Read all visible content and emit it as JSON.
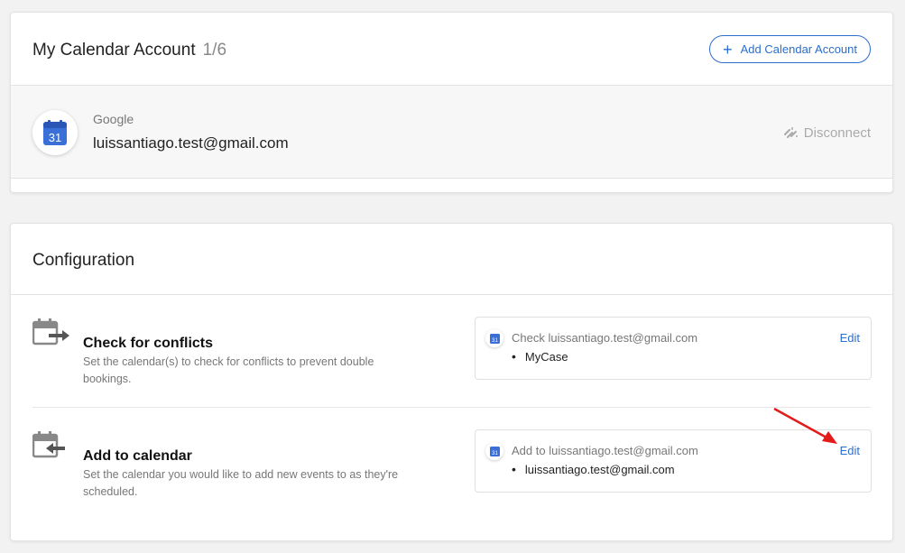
{
  "account_card": {
    "title": "My Calendar Account",
    "count": "1/6",
    "add_button_label": "Add Calendar Account",
    "account": {
      "provider": "Google",
      "email": "luissantiago.test@gmail.com",
      "calendar_icon_day": "31",
      "disconnect_label": "Disconnect"
    }
  },
  "config_card": {
    "title": "Configuration",
    "sections": [
      {
        "title": "Check for conflicts",
        "description": "Set the calendar(s) to check for conflicts to prevent double bookings.",
        "panel_label": "Check luissantiago.test@gmail.com",
        "edit_label": "Edit",
        "items": [
          "MyCase"
        ]
      },
      {
        "title": "Add to calendar",
        "description": "Set the calendar you would like to add new events to as they're scheduled.",
        "panel_label": "Add to luissantiago.test@gmail.com",
        "edit_label": "Edit",
        "items": [
          "luissantiago.test@gmail.com"
        ]
      }
    ]
  },
  "colors": {
    "accent": "#2c6ecb",
    "google_blue": "#3b6fd8",
    "annotation_arrow": "#e31b1b"
  },
  "icons": {
    "add": "plus-icon",
    "disconnect": "unlink-icon",
    "calendar": "google-calendar-icon",
    "conflicts": "calendar-arrow-out-icon",
    "add_to": "calendar-arrow-in-icon"
  }
}
